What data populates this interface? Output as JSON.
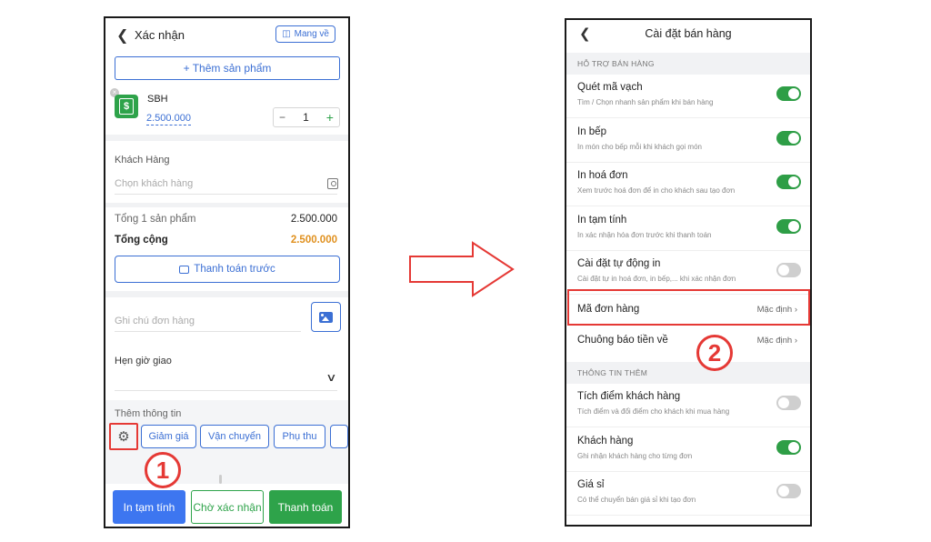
{
  "left": {
    "header": {
      "title": "Xác nhận",
      "mang_ve": "Mang về"
    },
    "add_product": "+ Thêm sản phẩm",
    "product": {
      "name": "SBH",
      "price": "2.500.000",
      "qty": "1",
      "icon_text": "$"
    },
    "customer": {
      "label": "Khách Hàng",
      "placeholder": "Chọn khách hàng"
    },
    "totals": {
      "items_label": "Tổng 1 sản phẩm",
      "items_value": "2.500.000",
      "total_label": "Tổng cộng",
      "total_value": "2.500.000"
    },
    "prepay": "Thanh toán trước",
    "note_placeholder": "Ghi chú đơn hàng",
    "delivery_label": "Hẹn giờ giao",
    "extra": {
      "label": "Thêm thông tin",
      "chips": [
        "Giảm giá",
        "Vận chuyển",
        "Phụ thu"
      ]
    },
    "marker": "1",
    "buttons": {
      "print": "In tạm tính",
      "wait": "Chờ xác nhận",
      "pay": "Thanh toán"
    }
  },
  "right": {
    "title": "Cài đặt bán hàng",
    "section1": "HỖ TRỢ BÁN HÀNG",
    "rows1": [
      {
        "title": "Quét mã vạch",
        "desc": "Tìm / Chọn nhanh sản phẩm khi bán hàng",
        "on": true
      },
      {
        "title": "In bếp",
        "desc": "In món cho bếp mỗi khi khách gọi món",
        "on": true
      },
      {
        "title": "In hoá đơn",
        "desc": "Xem trước hoá đơn để in cho khách sau tạo đơn",
        "on": true
      },
      {
        "title": "In tạm tính",
        "desc": "In xác nhận hóa đơn trước khi thanh toán",
        "on": true
      },
      {
        "title": "Cài đặt tự động in",
        "desc": "Cài đặt tự in hoá đơn, in bếp,... khi xác nhận đơn",
        "on": false
      }
    ],
    "links": [
      {
        "title": "Mã đơn hàng",
        "value": "Mặc định"
      },
      {
        "title": "Chuông báo tiền về",
        "value": "Mặc định"
      }
    ],
    "section2": "THÔNG TIN THÊM",
    "rows2": [
      {
        "title": "Tích điểm khách hàng",
        "desc": "Tích điểm và đổi điểm cho khách khi mua hàng",
        "on": false
      },
      {
        "title": "Khách hàng",
        "desc": "Ghi nhận khách hàng cho từng đơn",
        "on": true
      },
      {
        "title": "Giá sỉ",
        "desc": "Có thể chuyển bán giá sỉ khi tạo đơn",
        "on": false
      }
    ],
    "marker": "2"
  },
  "colors": {
    "blue": "#3b6fd4",
    "green": "#2e9e46",
    "red": "#e53935",
    "orange": "#e0901e"
  }
}
